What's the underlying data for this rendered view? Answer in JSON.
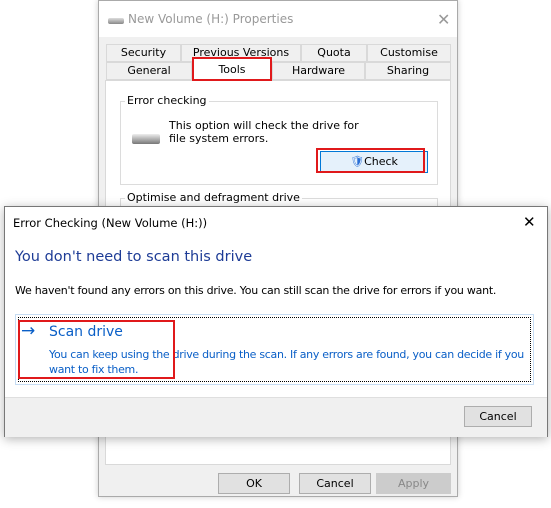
{
  "properties": {
    "title": "New Volume (H:) Properties",
    "tabs_row1": [
      "Security",
      "Previous Versions",
      "Quota",
      "Customise"
    ],
    "tabs_row2": [
      "General",
      "Tools",
      "Hardware",
      "Sharing"
    ],
    "error_group": "Error checking",
    "error_desc": "This option will check the drive for file system errors.",
    "check_label": "Check",
    "optimise_group": "Optimise and defragment drive",
    "ok": "OK",
    "cancel": "Cancel",
    "apply": "Apply"
  },
  "dialog": {
    "title": "Error Checking (New Volume (H:))",
    "heading": "You don't need to scan this drive",
    "message": "We haven't found any errors on this drive. You can still scan the drive for errors if you want.",
    "scan_label": "Scan drive",
    "scan_desc": "You can keep using the drive during the scan. If any errors are found, you can decide if you want to fix them.",
    "cancel": "Cancel"
  },
  "colors": {
    "highlight": "#e0191b",
    "link": "#0a5fc7",
    "heading": "#1e3c96"
  }
}
